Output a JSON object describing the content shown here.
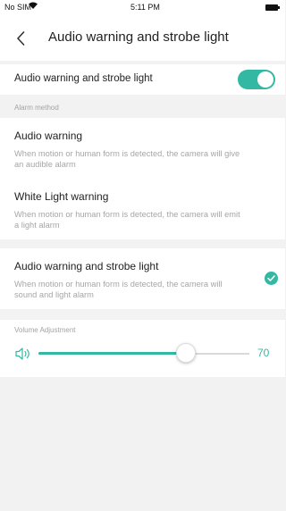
{
  "status_bar": {
    "carrier": "No SIM",
    "time": "5:11 PM"
  },
  "nav": {
    "title": "Audio warning and strobe light"
  },
  "toggle": {
    "label": "Audio warning and strobe light",
    "enabled": true
  },
  "alarm_method": {
    "section_label": "Alarm method",
    "options": [
      {
        "title": "Audio warning",
        "description": "When motion or human form is detected, the camera will give an audible alarm",
        "selected": false
      },
      {
        "title": "White Light warning",
        "description": "When motion or human form is detected, the camera will emit a light alarm",
        "selected": false
      },
      {
        "title": "Audio warning and strobe light",
        "description": "When motion or human form is detected, the camera will sound and light alarm",
        "selected": true
      }
    ]
  },
  "volume": {
    "label": "Volume Adjustment",
    "value": "70",
    "level_percent": 70
  },
  "colors": {
    "accent": "#33b8a3",
    "background": "#f2f2f2",
    "muted_text": "#a6a6a6"
  },
  "icons": {
    "back": "chevron-left-icon",
    "speaker": "speaker-icon",
    "check": "check-circle-icon",
    "wifi": "wifi-icon",
    "battery": "battery-icon"
  }
}
